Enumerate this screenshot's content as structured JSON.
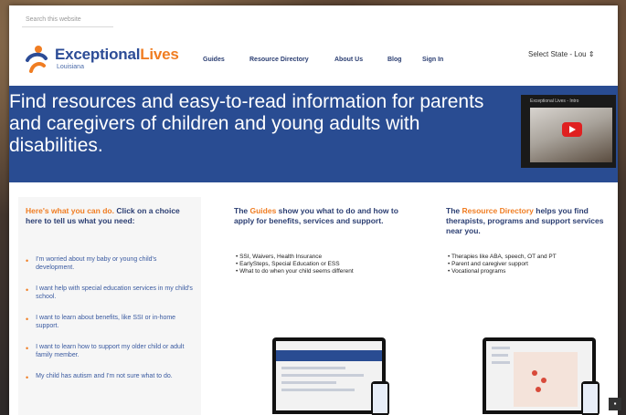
{
  "search": {
    "placeholder": "Search this website"
  },
  "brand": {
    "name_part1": "Exceptional",
    "name_part2": "Lives",
    "region": "Louisiana",
    "accent_color": "#f07d22",
    "primary_color": "#294c92"
  },
  "nav": {
    "items": [
      {
        "label": "Guides"
      },
      {
        "label": "Resource Directory"
      },
      {
        "label": "About Us"
      },
      {
        "label": "Blog"
      },
      {
        "label": "Sign In"
      }
    ]
  },
  "state_select": {
    "value": "Select State - Lou"
  },
  "hero": {
    "text": "Find resources and easy-to-read information for parents and caregivers of children and young adults with disabilities."
  },
  "video": {
    "title": "Exceptional Lives - Intro",
    "icon": "youtube-play-icon"
  },
  "left_column": {
    "heading_orange": "Here's what you can do.",
    "heading_rest": " Click on a choice here to tell us what you need:",
    "choices": [
      {
        "label": "I'm worried about my baby or young child's development."
      },
      {
        "label": "I want help with special education services in my child's school."
      },
      {
        "label": "I want to learn about benefits, like SSI or in-home support."
      },
      {
        "label": "I want to learn how to support my older child or adult family member."
      },
      {
        "label": "My child has autism and I'm not sure what to do."
      }
    ]
  },
  "middle_column": {
    "heading_pre": "The ",
    "heading_orange": "Guides",
    "heading_rest": " show you what to do and how to apply for benefits, services and support.",
    "bullets": [
      "SSI, Waivers, Health Insurance",
      "EarlySteps, Special Education or ESS",
      "What to do when your child seems different"
    ]
  },
  "right_column": {
    "heading_pre": "The ",
    "heading_orange": "Resource Directory",
    "heading_rest": " helps you find therapists, programs and support services near you.",
    "bullets": [
      "Therapies like ABA, speech, OT and PT",
      "Parent and caregiver support",
      "Vocational programs"
    ]
  }
}
